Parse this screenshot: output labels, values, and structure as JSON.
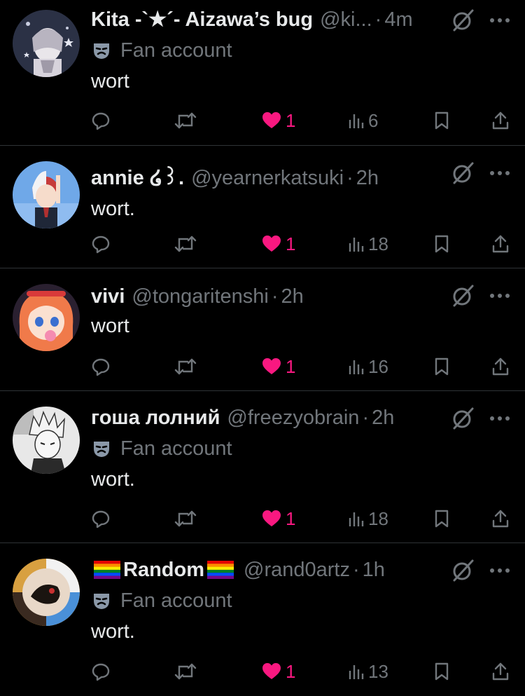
{
  "tweets": [
    {
      "display_name": "Kita -`★´- Aizawa’s bug",
      "handle": "@ki...",
      "separator": "·",
      "time": "4m",
      "label": "Fan account",
      "content": "wort",
      "likes": "1",
      "views": "6"
    },
    {
      "display_name": "annie ໒꒱.",
      "handle": "@yearnerkatsuki",
      "separator": "·",
      "time": "2h",
      "content": "wort.",
      "likes": "1",
      "views": "18"
    },
    {
      "display_name": "vivi",
      "handle": "@tongaritenshi",
      "separator": "·",
      "time": "2h",
      "content": "wort",
      "likes": "1",
      "views": "16"
    },
    {
      "display_name": "гоша лолний",
      "handle": "@freezyobrain",
      "separator": "·",
      "time": "2h",
      "label": "Fan account",
      "content": "wort.",
      "likes": "1",
      "views": "18"
    },
    {
      "display_name": "Random",
      "handle": "@rand0artz",
      "separator": "·",
      "time": "1h",
      "label": "Fan account",
      "content": "wort.",
      "likes": "1",
      "views": "13"
    }
  ],
  "colors": {
    "background": "#000000",
    "text": "#e7e9ea",
    "secondary": "#71767b",
    "like": "#f91880",
    "divider": "#2f3336"
  },
  "icons": [
    "grok-icon",
    "more-icon",
    "mask-icon",
    "reply-icon",
    "retweet-icon",
    "heart-icon",
    "views-icon",
    "bookmark-icon",
    "share-icon",
    "rainbow-flag-icon"
  ]
}
